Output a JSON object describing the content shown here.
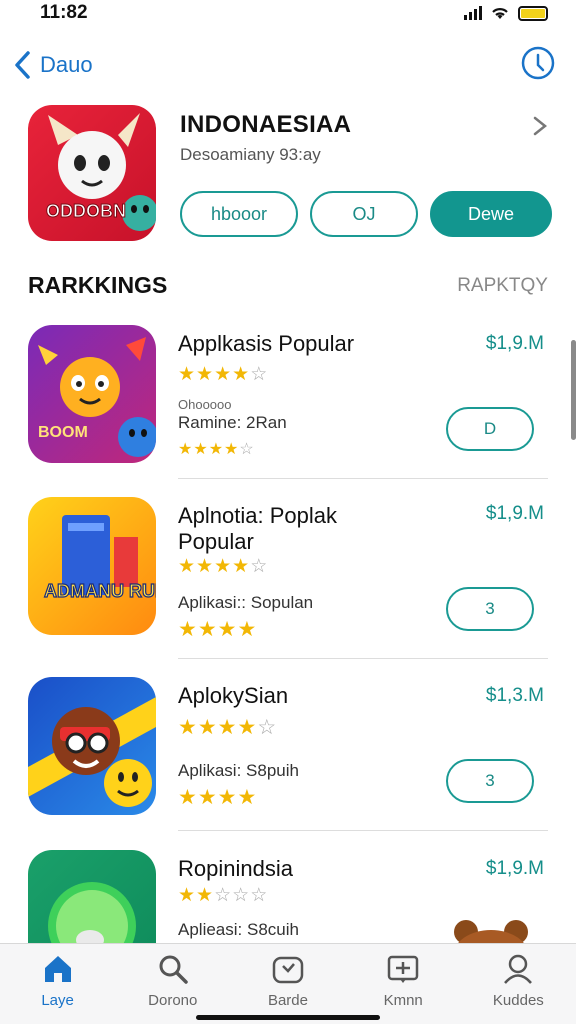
{
  "status": {
    "time": "11:82"
  },
  "nav": {
    "back_label": "Dauo"
  },
  "hero": {
    "title": "INDONAESIAA",
    "subtitle": "Desoamiany 93:ay",
    "icon_text": "ODDOBN",
    "buttons": [
      "hbooor",
      "OJ",
      "Dewe"
    ]
  },
  "section": {
    "title": "RARKKINGS",
    "link": "RAPKTQY"
  },
  "apps": [
    {
      "name": "Applkasis Popular",
      "price": "$1,9.M",
      "stars": "★★★★☆",
      "sub_small": "Ohooooo",
      "sub": "Ramine: 2Ran",
      "sub_stars": "★★★★☆",
      "button": "D",
      "icon_text": "BOOM"
    },
    {
      "name": "Aplnotia: Poplak Popular",
      "price": "$1,9.M",
      "stars": "★★★★☆",
      "sub": "Aplikasi:: Sopulan",
      "sub_stars": "★★★★",
      "button": "3",
      "icon_text": "ADMANU RUNS"
    },
    {
      "name": "AplokySian",
      "price": "$1,3.M",
      "stars": "★★★★☆",
      "sub": "Aplikasi: S8puih",
      "sub_stars": "★★★★",
      "button": "3",
      "icon_text": ""
    },
    {
      "name": "Ropinindsia",
      "price": "$1,9.M",
      "stars": "★★☆☆☆",
      "sub": "Aplieasi: S8cuih",
      "sub_stars": "",
      "button": "",
      "icon_text": ""
    }
  ],
  "tabs": [
    {
      "label": "Laye",
      "icon": "home-icon",
      "active": true
    },
    {
      "label": "Dorono",
      "icon": "search-icon"
    },
    {
      "label": "Barde",
      "icon": "games-icon"
    },
    {
      "label": "Kmnn",
      "icon": "apps-icon"
    },
    {
      "label": "Kuddes",
      "icon": "account-icon"
    }
  ],
  "colors": {
    "accent": "#12968f",
    "link": "#1a73c8",
    "star": "#f2b705"
  }
}
